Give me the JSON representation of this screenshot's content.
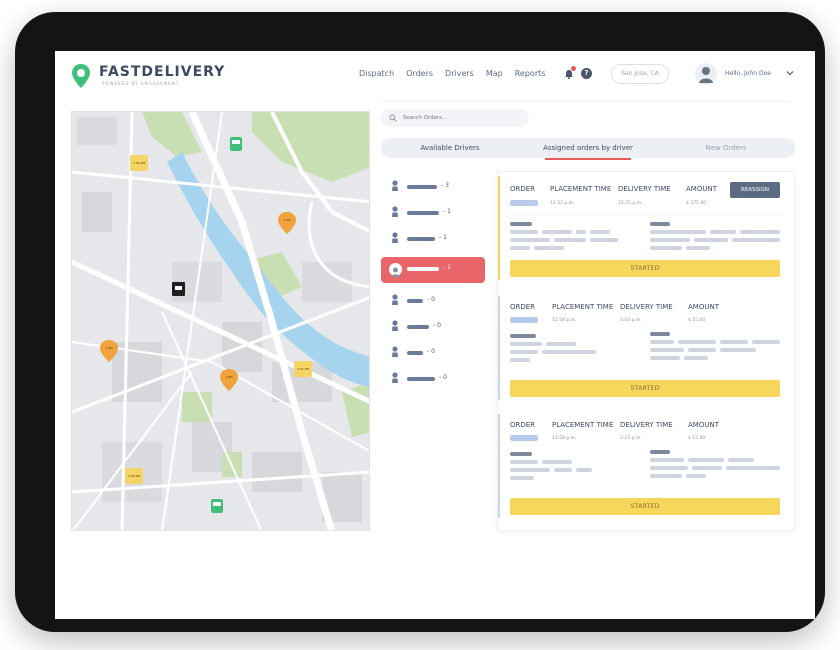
{
  "brand": {
    "name": "FASTDELIVERY",
    "tagline": "POWERED BY ENGAGEMENT"
  },
  "nav": [
    "Dispatch",
    "Orders",
    "Drivers",
    "Map",
    "Reports"
  ],
  "header": {
    "location": "San Jose, CA",
    "greeting": "Hello, John Doe"
  },
  "search": {
    "placeholder": "Search Orders..."
  },
  "tabs": [
    {
      "label": "Available Drivers",
      "state": "default"
    },
    {
      "label": "Assigned orders by driver",
      "state": "active"
    },
    {
      "label": "New Orders",
      "state": "muted"
    }
  ],
  "drivers": [
    {
      "count": "- 3"
    },
    {
      "count": "- 1"
    },
    {
      "count": "- 1"
    },
    {
      "count": "- 1",
      "selected": true
    },
    {
      "count": "- 0"
    },
    {
      "count": "- 0"
    },
    {
      "count": "- 0"
    },
    {
      "count": "- 0"
    }
  ],
  "columns": {
    "order": "ORDER",
    "placement": "PLACEMENT TIME",
    "delivery": "DELIVERY TIME",
    "amount": "AMOUNT"
  },
  "orders": [
    {
      "placement": "12:32 p.m.",
      "delivery": "12:25 p.m.",
      "amount": "$ 375.00",
      "action": "REASSIGN",
      "status": "STARTED"
    },
    {
      "placement": "12:58 p.m.",
      "delivery": "1:03 p.m.",
      "amount": "$ 15.00",
      "status": "STARTED"
    },
    {
      "placement": "12:58 p.m.",
      "delivery": "2:23 p.m.",
      "amount": "$ 15.00",
      "status": "STARTED"
    }
  ],
  "map_pins": [
    {
      "label": "1:00 PM"
    },
    {
      "label": "3 PM"
    },
    {
      "label": "2 PM"
    },
    {
      "label": "1 PM"
    },
    {
      "label": "3:31 PM"
    },
    {
      "label": "2:58 PM"
    }
  ],
  "colors": {
    "accent": "#e8666a",
    "started": "#f7d65c",
    "pin": "#f0a23b",
    "river": "#a6d4ee",
    "park": "#c7dfb3"
  }
}
